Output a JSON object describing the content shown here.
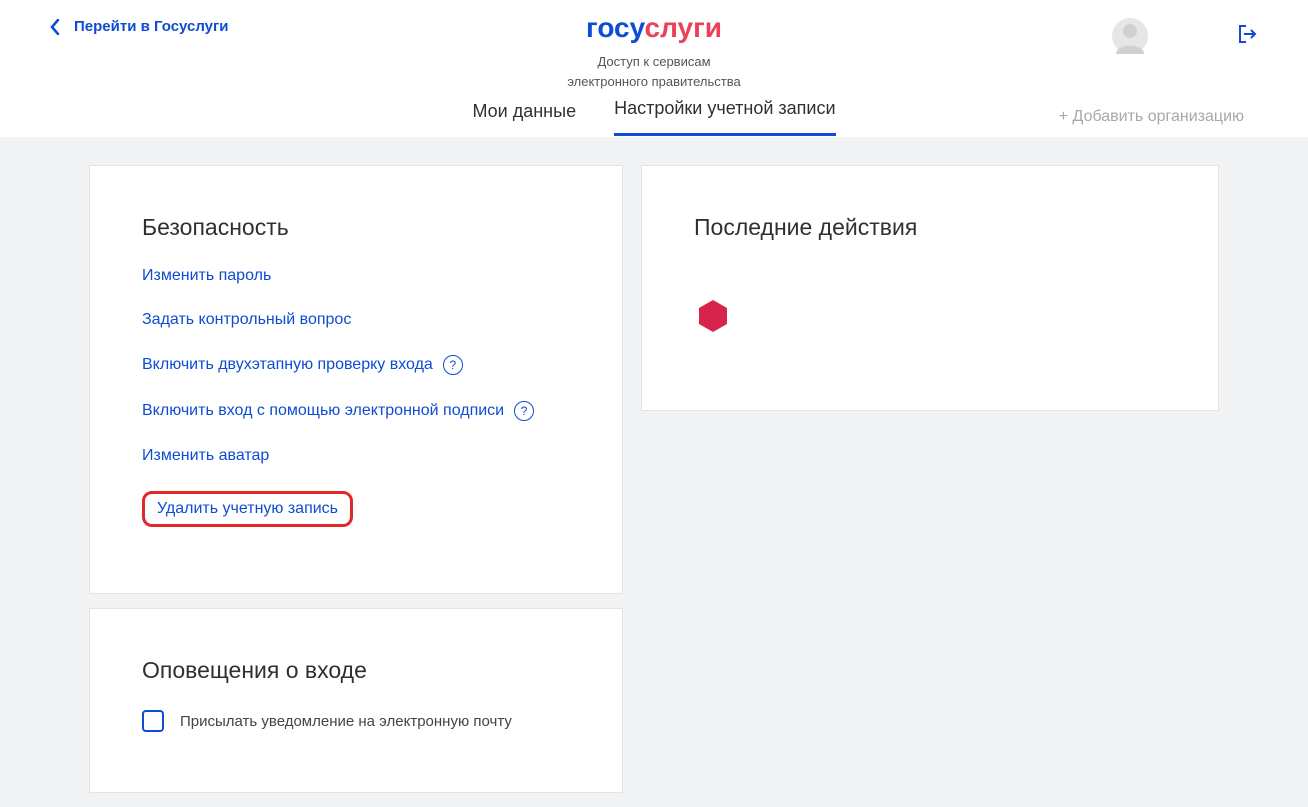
{
  "header": {
    "back_label": "Перейти в Госуслуги",
    "logo_part1": "госу",
    "logo_part2": "слуги",
    "tagline_line1": "Доступ к сервисам",
    "tagline_line2": "электронного правительства"
  },
  "tabs": {
    "my_data": "Мои данные",
    "settings": "Настройки учетной записи",
    "add_org": "+ Добавить организацию"
  },
  "security": {
    "title": "Безопасность",
    "change_password": "Изменить пароль",
    "set_question": "Задать контрольный вопрос",
    "two_step": "Включить двухэтапную проверку входа",
    "esig": "Включить вход с помощью электронной подписи",
    "change_avatar": "Изменить аватар",
    "delete_account": "Удалить учетную запись"
  },
  "notifications": {
    "title": "Оповещения о входе",
    "email_label": "Присылать уведомление на электронную почту"
  },
  "recent": {
    "title": "Последние действия"
  }
}
